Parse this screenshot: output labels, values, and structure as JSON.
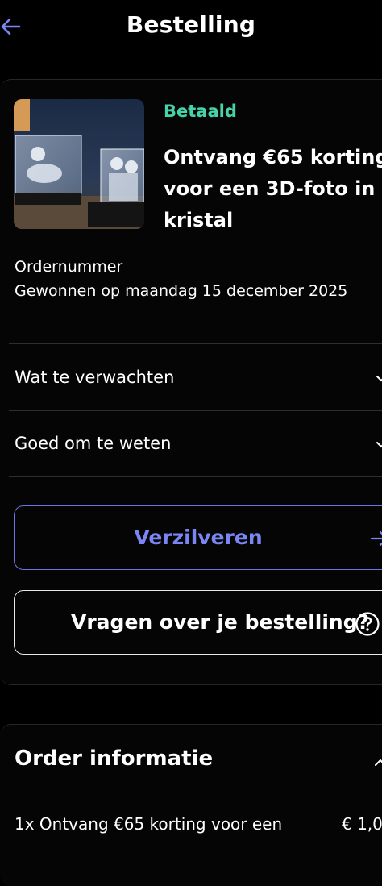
{
  "header": {
    "title": "Bestelling",
    "back_icon": "arrow-left-icon",
    "accent": "#7b86f5"
  },
  "product": {
    "status": "Betaald",
    "status_color": "#46d3a7",
    "title": "Ontvang €65 korting voor een 3D-foto in kristal",
    "image": "crystal-3d-photo-image"
  },
  "order": {
    "number_label": "Ordernummer",
    "won_on": "Gewonnen op maandag 15 december 2025"
  },
  "accordion": [
    {
      "label": "Wat te verwachten",
      "icon": "chevron-down-icon"
    },
    {
      "label": "Goed om te weten",
      "icon": "chevron-down-icon"
    }
  ],
  "actions": {
    "redeem_label": "Verzilveren",
    "redeem_icon": "arrow-right-icon",
    "questions_label": "Vragen over je bestelling?",
    "questions_icon": "question-circle-icon"
  },
  "order_info": {
    "title": "Order informatie",
    "icon": "chevron-up-icon",
    "line_item": "1x   Ontvang €65 korting voor een",
    "price": "€ 1,0"
  }
}
